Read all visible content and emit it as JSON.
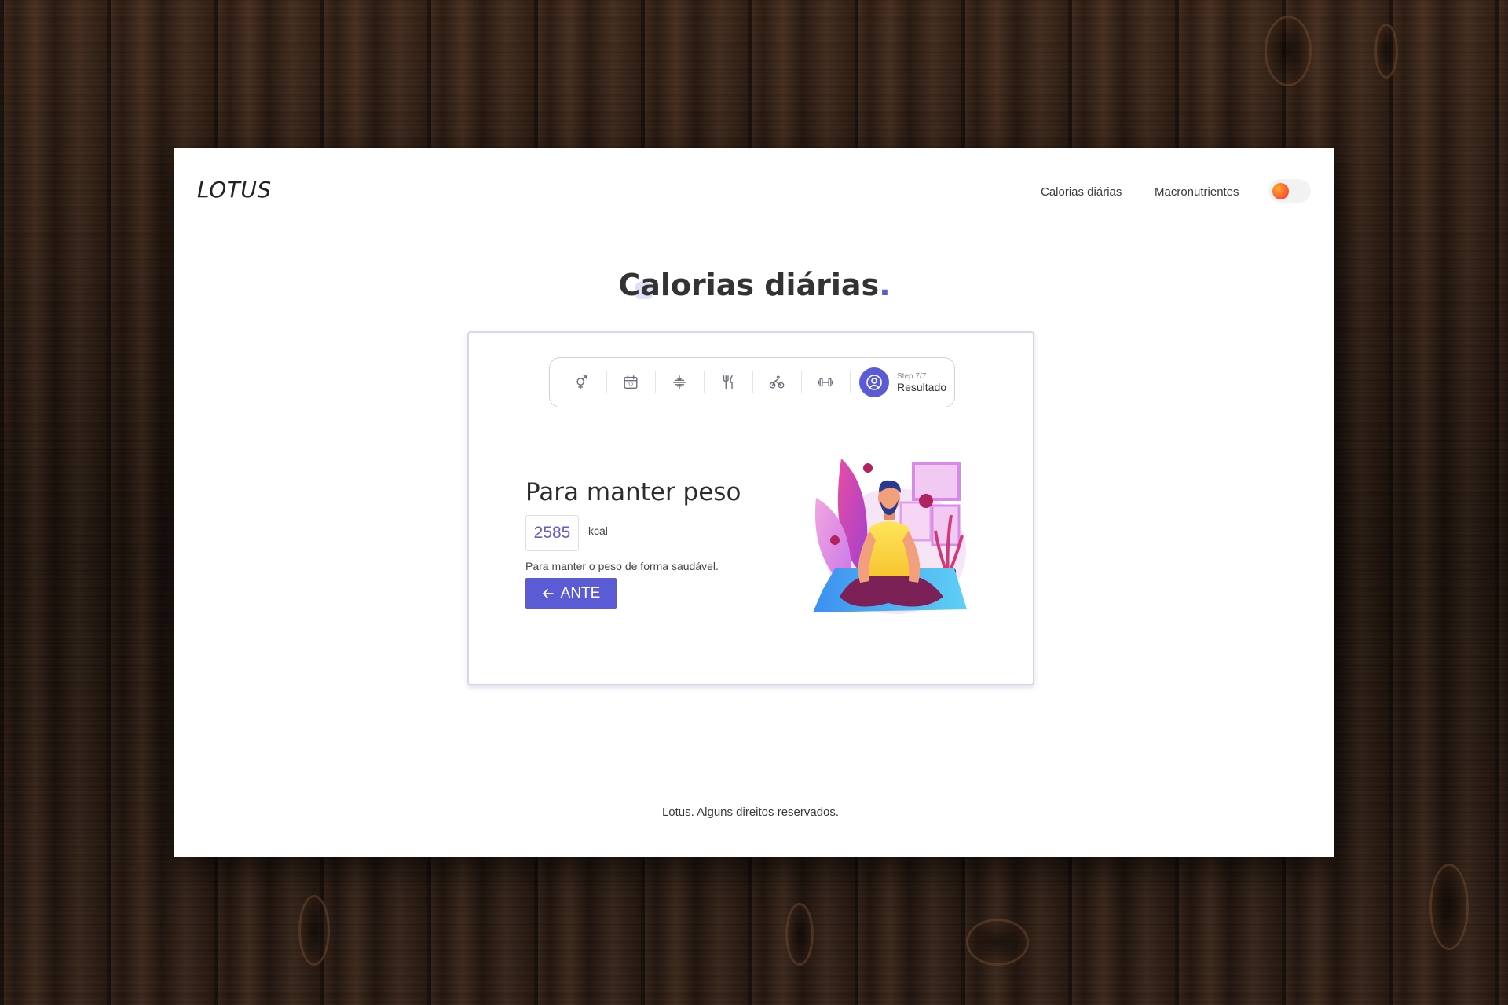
{
  "app": {
    "logo": "LOTUS"
  },
  "nav": {
    "items": [
      {
        "label": "Calorias diárias"
      },
      {
        "label": "Macronutrientes"
      }
    ],
    "theme_toggle_colors": [
      "#ffb02e",
      "#e8344c"
    ]
  },
  "page": {
    "title": "Calorias diárias",
    "title_dot": "."
  },
  "stepper": {
    "steps": [
      {
        "icon": "gender-icon"
      },
      {
        "icon": "calendar-icon",
        "text": "12"
      },
      {
        "icon": "height-icon"
      },
      {
        "icon": "fork-knife-icon"
      },
      {
        "icon": "bicycle-icon"
      },
      {
        "icon": "dumbbell-icon"
      }
    ],
    "active": {
      "icon": "user-circle-icon",
      "count": "Step 7/7",
      "label": "Resultado"
    }
  },
  "result": {
    "heading": "Para manter peso",
    "kcal_value": "2585",
    "kcal_unit": "kcal",
    "description": "Para manter o peso de forma saudável.",
    "back_button": {
      "icon": "arrow-left-icon",
      "label": "ANTE"
    }
  },
  "footer": {
    "text": "Lotus. Alguns direitos reservados."
  },
  "colors": {
    "accent": "#5b5bd6",
    "kcal_text": "#6a5bc6"
  }
}
